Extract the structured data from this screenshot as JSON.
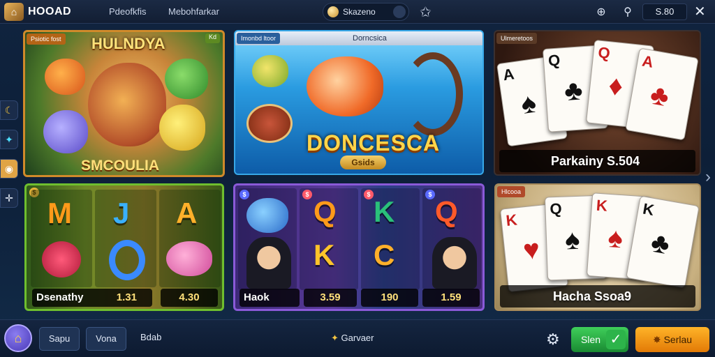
{
  "header": {
    "logo_text": "HOOAD",
    "nav": [
      "Pdeofkfis",
      "Mebohfarkar"
    ],
    "user_name": "Skazeno",
    "balance": "S.80"
  },
  "tiles": {
    "fish_mania": {
      "tag": "Psiotic fost",
      "tag_right": "Kd",
      "title": "HULNDYA",
      "subtitle": "SMCOULIA"
    },
    "ocean": {
      "tag": "Imonbd ltoor",
      "header_title": "Dorncsica",
      "title": "DONCESCA",
      "subtitle": "Gsids"
    },
    "cards_top": {
      "tag": "Ulmeretoos",
      "caption": "Parkainy S.504",
      "cards": [
        {
          "rank": "A",
          "suit": "♠",
          "color": "#111111"
        },
        {
          "rank": "Q",
          "suit": "♣",
          "color": "#111111"
        },
        {
          "rank": "Q",
          "suit": "♦",
          "color": "#c81e1e"
        },
        {
          "rank": "A",
          "suit": "♣",
          "color": "#c81e1e"
        }
      ]
    },
    "reels_green": {
      "symbols": [
        "M",
        "J",
        "A"
      ],
      "label": "Dsenathy",
      "value1": "1.31",
      "value2": "4.30"
    },
    "reels_purple": {
      "symbols": [
        "Q",
        "K",
        "K",
        "C",
        "Q"
      ],
      "label": "Haok",
      "values": [
        "3.59",
        "190",
        "1.59"
      ]
    },
    "cards_bottom": {
      "tag": "Hlcooa",
      "caption": "Hacha Ssoa9",
      "cards": [
        {
          "rank": "K",
          "suit": "♥",
          "color": "#c81e1e"
        },
        {
          "rank": "Q",
          "suit": "♠",
          "color": "#111111"
        },
        {
          "rank": "K",
          "suit": "♠",
          "color": "#c81e1e"
        },
        {
          "rank": "K",
          "suit": "♣",
          "color": "#111111"
        }
      ]
    }
  },
  "footer": {
    "btn1": "Sapu",
    "btn2": "Vona",
    "text": "Bdab",
    "center": "Garvaer",
    "btn_green": "Slen",
    "btn_orange": "Serlau"
  },
  "colors": {
    "accent_orange": "#f59e0b",
    "accent_green": "#22b14c",
    "bg": "#10243f"
  }
}
